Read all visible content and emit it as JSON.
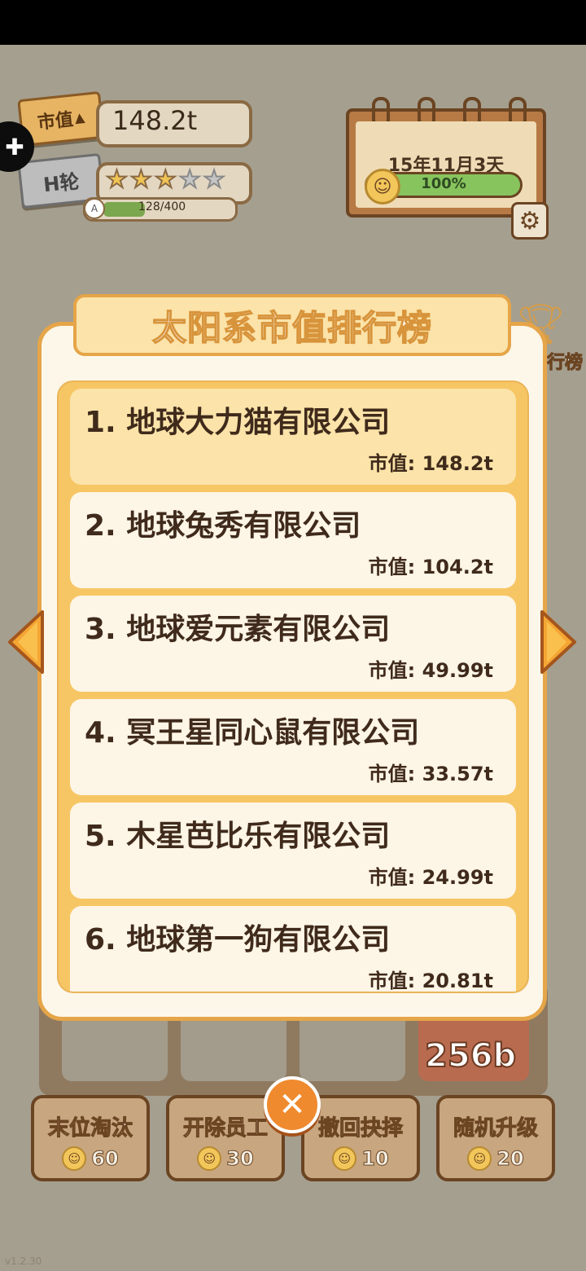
{
  "hud": {
    "market_value_badge": "市值",
    "market_value": "148.2t",
    "round_badge": "H轮",
    "stars_filled": 3,
    "stars_total": 5,
    "rank_letter": "A",
    "xp_text": "128/400",
    "xp_current": 128,
    "xp_max": 400
  },
  "calendar": {
    "date": "15年11月3天",
    "mood_percent_text": "100%",
    "mood_percent": 100
  },
  "side": {
    "rank_label": "行榜"
  },
  "modal": {
    "title": "太阳系市值排行榜",
    "rows": [
      {
        "name": "1. 地球大力猫有限公司",
        "value": "市值: 148.2t"
      },
      {
        "name": "2. 地球兔秀有限公司",
        "value": "市值: 104.2t"
      },
      {
        "name": "3. 地球爱元素有限公司",
        "value": "市值: 49.99t"
      },
      {
        "name": "4. 冥王星同心鼠有限公司",
        "value": "市值: 33.57t"
      },
      {
        "name": "5. 木星芭比乐有限公司",
        "value": "市值: 24.99t"
      },
      {
        "name": "6. 地球第一狗有限公司",
        "value": "市值: 20.81t"
      }
    ]
  },
  "board": {
    "chef_value": "256b"
  },
  "actions": [
    {
      "label": "末位淘汰",
      "cost": "60"
    },
    {
      "label": "开除员工",
      "cost": "30"
    },
    {
      "label": "撤回抉择",
      "cost": "10"
    },
    {
      "label": "随机升级",
      "cost": "20"
    }
  ],
  "version": "v1.2.30",
  "colors": {
    "accent_orange": "#e5a548",
    "panel_bg": "#fdf7ea",
    "list_bg": "#f7c664",
    "row_top_bg": "#fbe3a9",
    "text_dark": "#3f2a1b",
    "game_bg": "#a59f8f"
  },
  "icons": [
    "puzzle-icon",
    "chart-icon",
    "star-icon",
    "smile-coin-icon",
    "gear-icon",
    "trophy-icon",
    "arrow-left-icon",
    "arrow-right-icon",
    "close-icon"
  ]
}
